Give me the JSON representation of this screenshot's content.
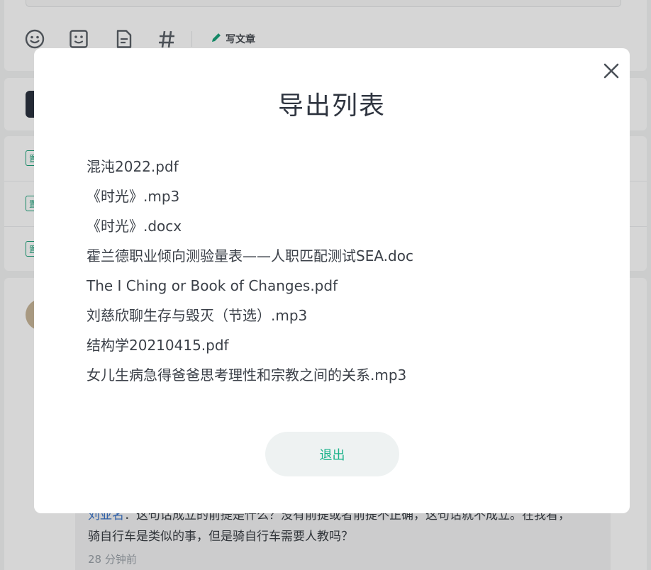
{
  "background": {
    "composer": {
      "tools": [
        {
          "icon": "emoji-icon"
        },
        {
          "icon": "image-icon"
        },
        {
          "icon": "document-icon"
        },
        {
          "icon": "hashtag-icon"
        }
      ],
      "write_article_label": "写文章"
    },
    "list_tags": [
      "置",
      "置",
      "置"
    ],
    "comment": {
      "author": "刘亚名",
      "line1_rest": "：这句话成立的前提是什么？没有前提或者前提不正确，这句话就不成立。在我看，",
      "line2": "骑自行车是类似的事，但是骑自行车需要人教吗？",
      "time": "28 分钟前"
    }
  },
  "modal": {
    "title": "导出列表",
    "files": [
      "混沌2022.pdf",
      "《时光》.mp3",
      "《时光》.docx",
      "霍兰德职业倾向测验量表——人职匹配测试SEA.doc",
      "The I Ching or Book of Changes.pdf",
      "刘慈欣聊生存与毁灭（节选）.mp3",
      "结构学20210415.pdf",
      "女儿生病急得爸爸思考理性和宗教之间的关系.mp3"
    ],
    "exit_label": "退出",
    "close_icon": "close-icon"
  },
  "colors": {
    "accent": "#1bb28a",
    "title": "#2f3540",
    "text": "#3b4048",
    "button_bg": "#eef2f2",
    "overlay": "rgba(0,0,0,0.16)"
  }
}
